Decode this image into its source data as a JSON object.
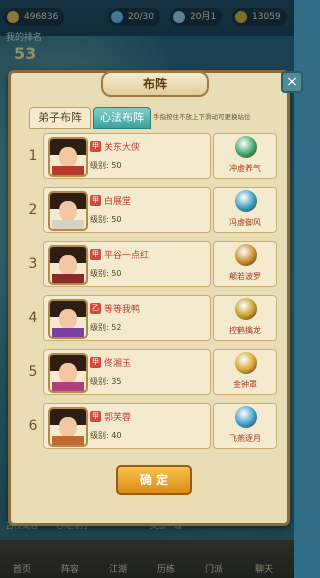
{
  "hud": {
    "coins": "496836",
    "energy": "20/30",
    "jade": "20月1",
    "gold": "13059",
    "rank_label": "我的排名",
    "rank_value": "53"
  },
  "modal": {
    "title": "布阵",
    "close": "×",
    "tabs": [
      "弟子布阵",
      "心法布阵"
    ],
    "active_tab": 1,
    "hint": "手指按住不放上下滑动可更换站位",
    "confirm": "确 定",
    "rows": [
      {
        "num": "1",
        "badge": "甲",
        "name": "关东大侠",
        "level": "级别: 50",
        "skill": "冲虚养气",
        "skill_color": "#3fa56a",
        "cloth": "#b43a2a"
      },
      {
        "num": "2",
        "badge": "甲",
        "name": "白展堂",
        "level": "级别: 50",
        "skill": "冯虚御风",
        "skill_color": "#3d9bbf",
        "cloth": "#d8d2c2"
      },
      {
        "num": "3",
        "badge": "甲",
        "name": "平谷一点红",
        "level": "级别: 50",
        "skill": "颠若波罗",
        "skill_color": "#c98a2a",
        "cloth": "#8a2a2a"
      },
      {
        "num": "4",
        "badge": "乙",
        "name": "等等我鸭",
        "level": "级别: 52",
        "skill": "控鹤擒龙",
        "skill_color": "#c99a1f",
        "cloth": "#7a3fa0"
      },
      {
        "num": "5",
        "badge": "甲",
        "name": "佟湘玉",
        "level": "级别: 35",
        "skill": "金钟罩",
        "skill_color": "#d6a22a",
        "cloth": "#b0407a"
      },
      {
        "num": "6",
        "badge": "甲",
        "name": "郭芙蓉",
        "level": "级别: 40",
        "skill": "飞燕逐月",
        "skill_color": "#3a9fcb",
        "cloth": "#c06a32"
      }
    ]
  },
  "nav": [
    "首页",
    "阵容",
    "江湖",
    "历练",
    "门派",
    "聊天"
  ],
  "bottom_strip": [
    "古楼商店",
    "心佬排行",
    "灵感一级"
  ]
}
